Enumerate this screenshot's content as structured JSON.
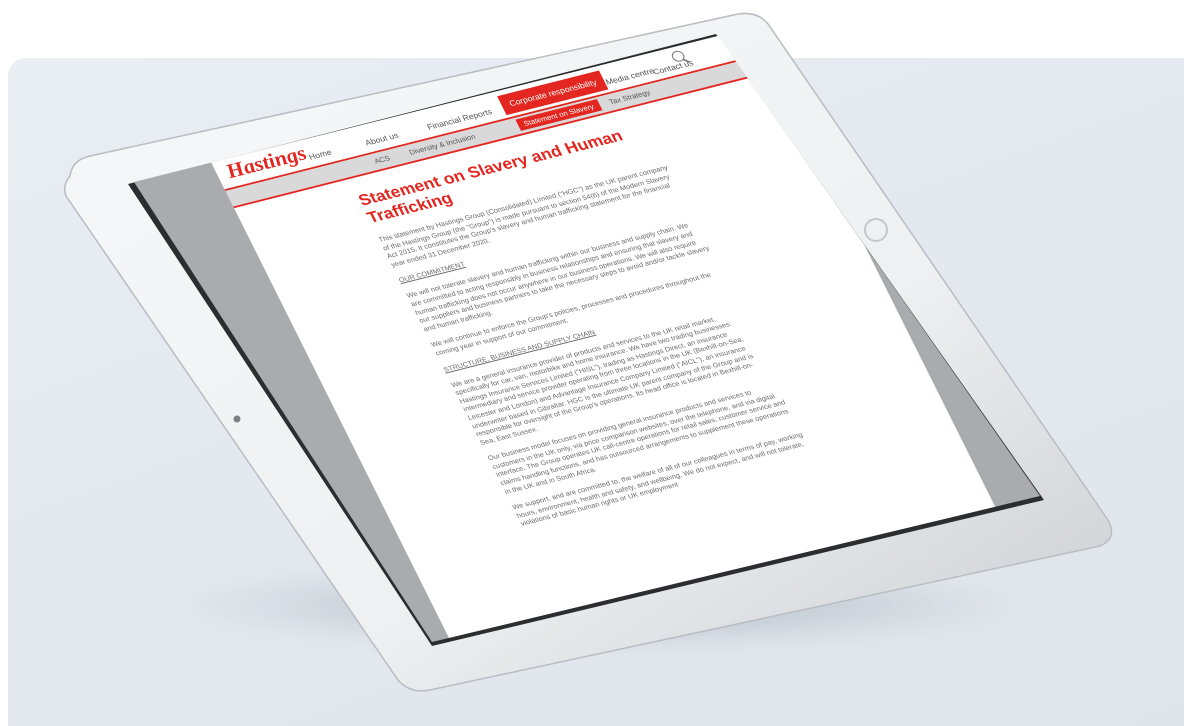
{
  "site": {
    "logo": "Hastings",
    "nav": [
      "Home",
      "About us",
      "Financial Reports",
      "Corporate responsibility",
      "Media centre",
      "Contact us"
    ],
    "active_nav": "Corporate responsibility",
    "subnav": [
      "ACS",
      "Diversity & Inclusion",
      "Statement on Slavery",
      "Tax Strategy"
    ],
    "active_subnav": "Statement on Slavery"
  },
  "article": {
    "title": "Statement on Slavery and Human Trafficking",
    "intro": "This statement by Hastings Group (Consolidated) Limited (\"HGC\") as the UK parent company of the Hastings Group (the \"Group\") is made pursuant to section 54(6) of the Modern Slavery Act 2015. It constitutes the Group's slavery and human trafficking statement for the financial year ended 31 December 2020.",
    "h1": "OUR COMMITMENT",
    "p1": "We will not tolerate slavery and human trafficking within our business and supply chain. We are committed to acting responsibly in business relationships and ensuring that slavery and human trafficking does not occur anywhere in our business operations. We will also require our suppliers and business partners to take the necessary steps to avoid and/or tackle slavery and human trafficking.",
    "p2": "We will continue to enforce the Group's policies, processes and procedures throughout the coming year in support of our commitment.",
    "h2": "STRUCTURE, BUSINESS AND SUPPLY CHAIN",
    "p3": "We are a general insurance provider of products and services to the UK retail market, specifically for car, van, motorbike and home insurance. We have two trading businesses: Hastings Insurance Services Limited (\"HISL\"), trading as Hastings Direct, an insurance intermediary and service provider operating from three locations in the UK (Bexhill-on-Sea, Leicester and London) and Advantage Insurance Company Limited (\"AICL\"), an insurance underwriter based in Gibraltar. HGC is the ultimate UK parent company of the Group and is responsible for oversight of the Group's operations. Its head office is located in Bexhill-on-Sea, East Sussex.",
    "p4": "Our business model focuses on providing general insurance products and services to customers in the UK only, via price comparison websites, over the telephone, and via digital interface. The Group operates UK call-centre operations for retail sales, customer service and claims handling functions, and has outsourced arrangements to supplement these operations in the UK and in South Africa.",
    "p5": "We support, and are committed to, the welfare of all of our colleagues in terms of pay, working hours, environment, health and safety, and wellbeing. We do not expect, and will not tolerate, violations of basic human rights or UK employment"
  },
  "colors": {
    "brand_red": "#e3261f",
    "backdrop": "#e5eaf0"
  }
}
